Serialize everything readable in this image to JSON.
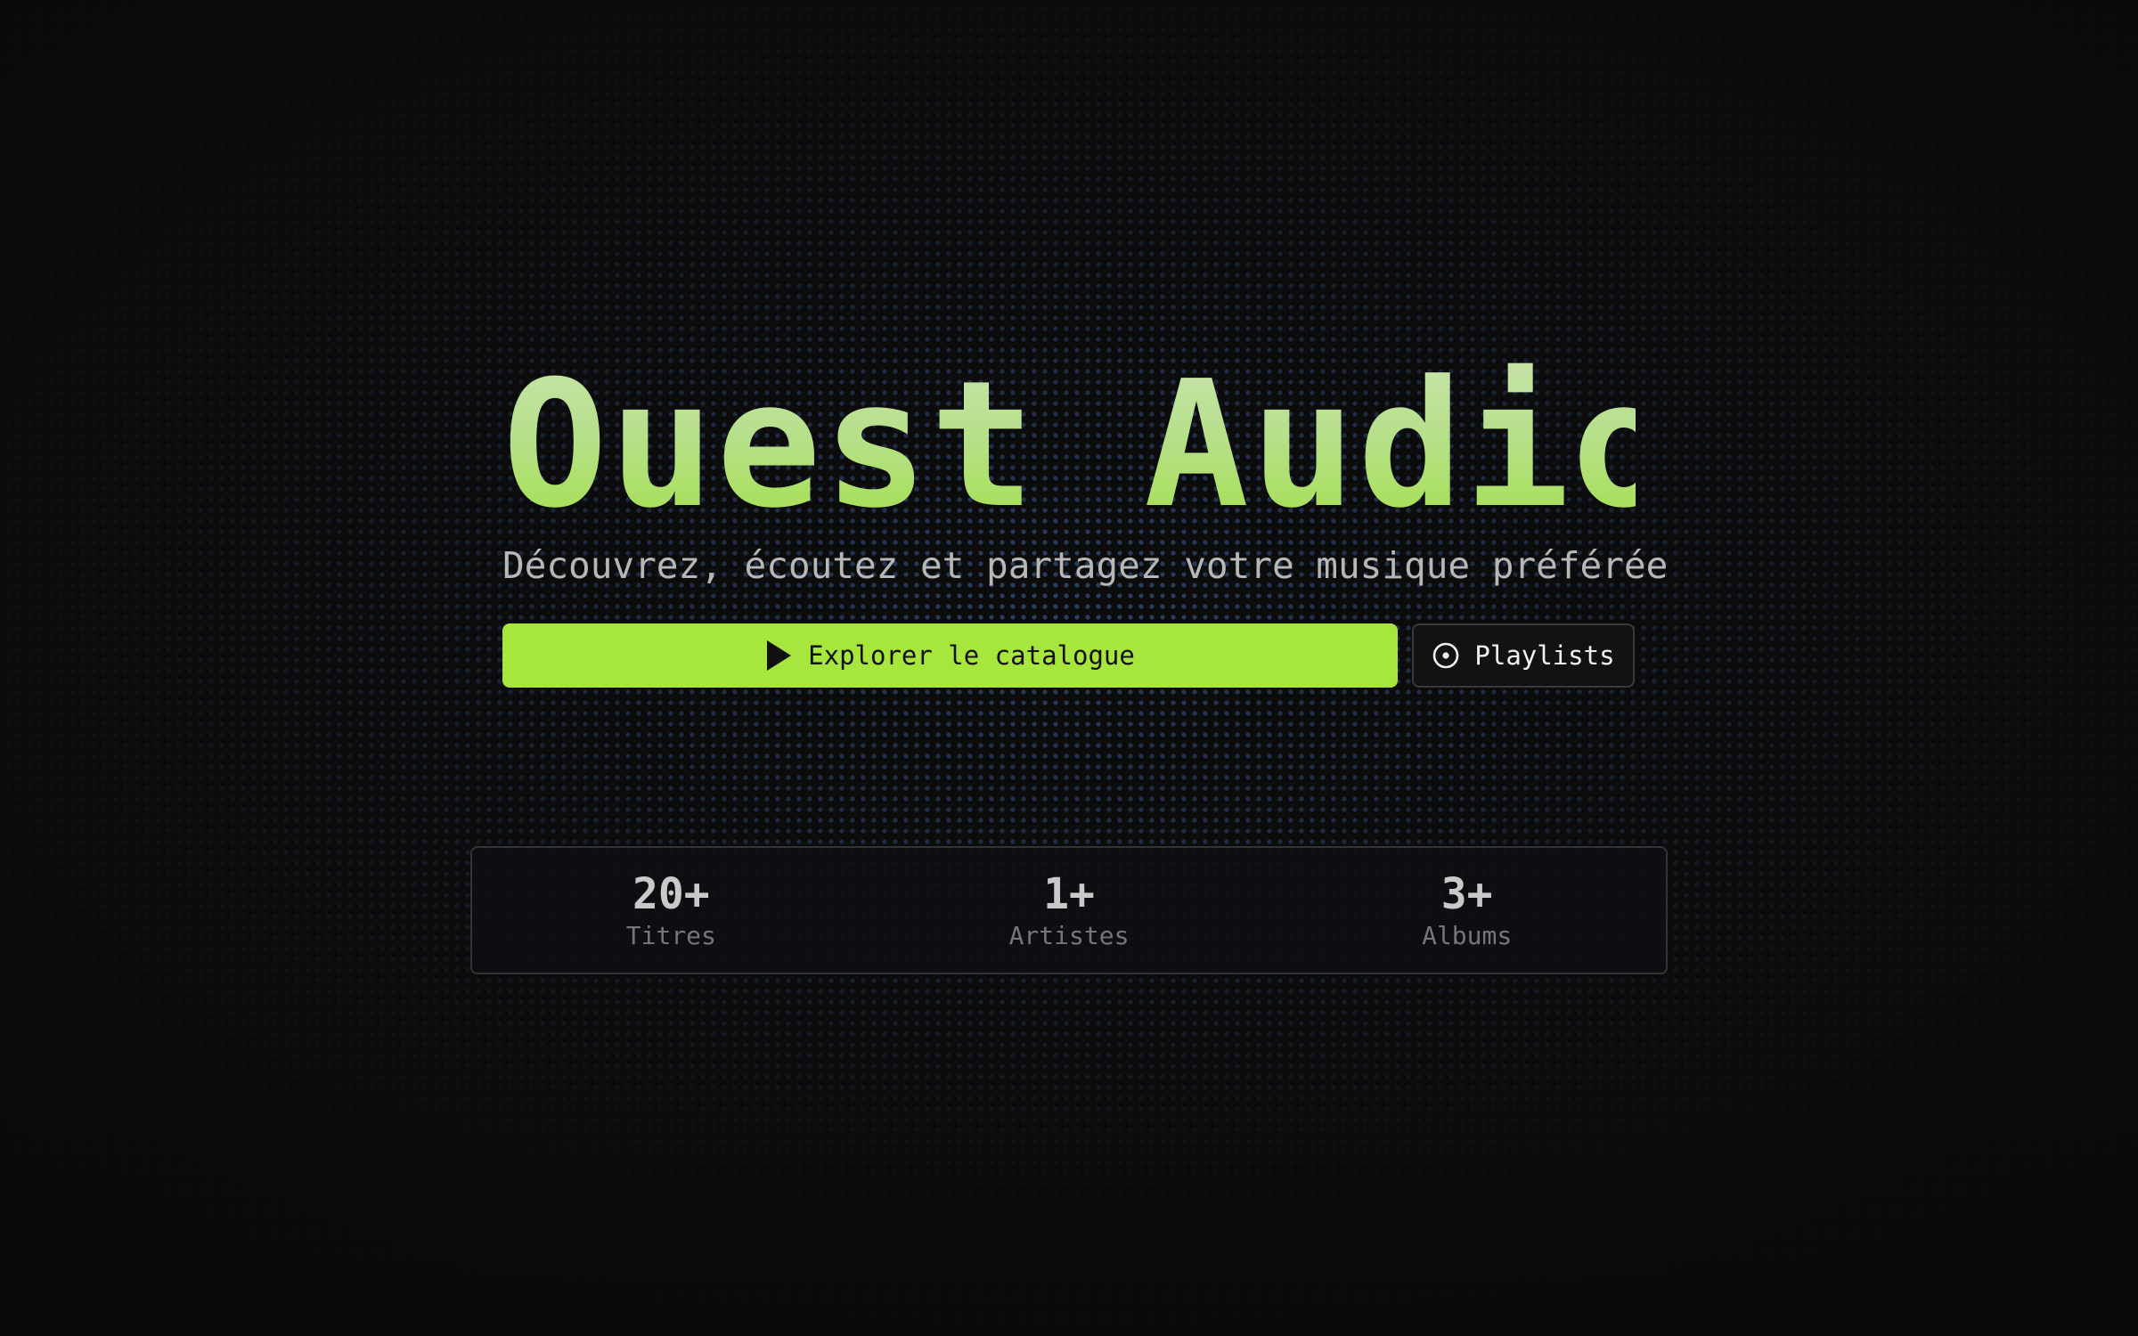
{
  "hero": {
    "title": "Ouest Audio",
    "subtitle": "Découvrez, écoutez et partagez votre musique préférée"
  },
  "actions": {
    "primary_label": "Explorer le catalogue",
    "primary_icon": "play-icon",
    "secondary_label": "Playlists",
    "secondary_icon": "disc-icon"
  },
  "stats": [
    {
      "value": "20+",
      "label": "Titres"
    },
    {
      "value": "1+",
      "label": "Artistes"
    },
    {
      "value": "3+",
      "label": "Albums"
    }
  ],
  "colors": {
    "accent": "#a6e63d",
    "background": "#0c0c0c",
    "dot_grid": "#4268a8"
  }
}
